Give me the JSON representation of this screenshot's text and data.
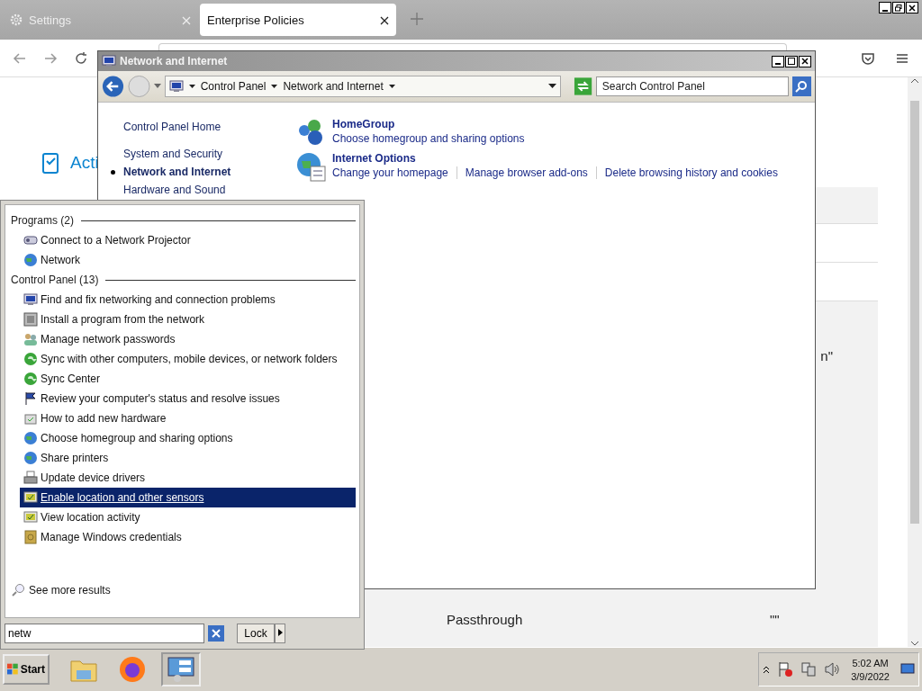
{
  "browser": {
    "tabs": [
      {
        "label": "Settings",
        "selected": false
      },
      {
        "label": "Enterprise Policies",
        "selected": true
      }
    ],
    "page": {
      "heading": "Acti",
      "fragment": "n\"",
      "row": {
        "label": "Passthrough",
        "value": "\"\""
      }
    }
  },
  "control_panel": {
    "title": "Network and Internet",
    "breadcrumb": [
      "Control Panel",
      "Network and Internet"
    ],
    "search": {
      "placeholder": "Search Control Panel"
    },
    "sidebar": [
      {
        "label": "Control Panel Home",
        "selected": false
      },
      {
        "label": "System and Security",
        "selected": false
      },
      {
        "label": "Network and Internet",
        "selected": true
      },
      {
        "label": "Hardware and Sound",
        "selected": false
      }
    ],
    "categories": [
      {
        "title": "HomeGroup",
        "links": [
          "Choose homegroup and sharing options"
        ]
      },
      {
        "title": "Internet Options",
        "links": [
          "Change your homepage",
          "Manage browser add-ons",
          "Delete browsing history and cookies"
        ]
      }
    ]
  },
  "start_menu": {
    "groups": [
      {
        "heading": "Programs (2)",
        "items": [
          {
            "label": "Connect to a Network Projector",
            "selected": false
          },
          {
            "label": "Network",
            "selected": false
          }
        ]
      },
      {
        "heading": "Control Panel (13)",
        "items": [
          {
            "label": "Find and fix networking and connection problems",
            "selected": false
          },
          {
            "label": "Install a program from the network",
            "selected": false
          },
          {
            "label": "Manage network passwords",
            "selected": false
          },
          {
            "label": "Sync with other computers, mobile devices, or network folders",
            "selected": false
          },
          {
            "label": "Sync Center",
            "selected": false
          },
          {
            "label": "Review your computer's status and resolve issues",
            "selected": false
          },
          {
            "label": "How to add new hardware",
            "selected": false
          },
          {
            "label": "Choose homegroup and sharing options",
            "selected": false
          },
          {
            "label": "Share printers",
            "selected": false
          },
          {
            "label": "Update device drivers",
            "selected": false
          },
          {
            "label": "Enable location and other sensors",
            "selected": true
          },
          {
            "label": "View location activity",
            "selected": false
          },
          {
            "label": "Manage Windows credentials",
            "selected": false
          }
        ]
      }
    ],
    "see_more": "See more results",
    "search": {
      "value": "netw"
    },
    "lock": "Lock"
  },
  "taskbar": {
    "start": "Start",
    "time": "5:02 AM",
    "date": "3/9/2022"
  }
}
